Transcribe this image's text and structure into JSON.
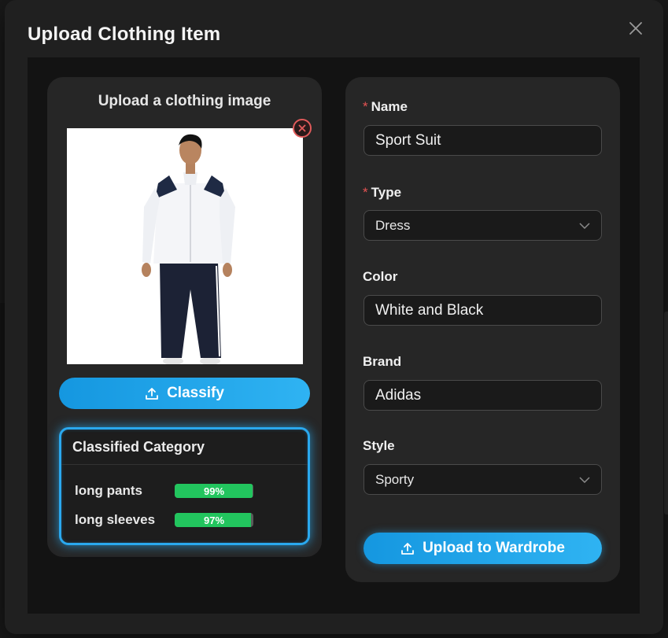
{
  "modal": {
    "title": "Upload Clothing Item"
  },
  "upload": {
    "title": "Upload a clothing image",
    "classify_label": "Classify"
  },
  "classification": {
    "title": "Classified Category",
    "results": [
      {
        "label": "long pants",
        "percent_text": "99%",
        "value": 0.99
      },
      {
        "label": "long sleeves",
        "percent_text": "97%",
        "value": 0.97
      }
    ]
  },
  "form": {
    "name": {
      "label": "Name",
      "required": "*",
      "value": "Sport Suit"
    },
    "type": {
      "label": "Type",
      "required": "*",
      "value": "Dress"
    },
    "color": {
      "label": "Color",
      "value": "White and Black"
    },
    "brand": {
      "label": "Brand",
      "value": "Adidas"
    },
    "style": {
      "label": "Style",
      "value": "Sporty"
    },
    "submit_label": "Upload to Wardrobe"
  },
  "icons": {
    "close": "close-icon",
    "remove": "remove-image-icon",
    "upload": "upload-icon",
    "dropdown": "chevron-down-icon"
  },
  "colors": {
    "accent": "#1597e0",
    "accent_light": "#2fb3f2",
    "success": "#22c55e",
    "danger": "#e55353"
  }
}
